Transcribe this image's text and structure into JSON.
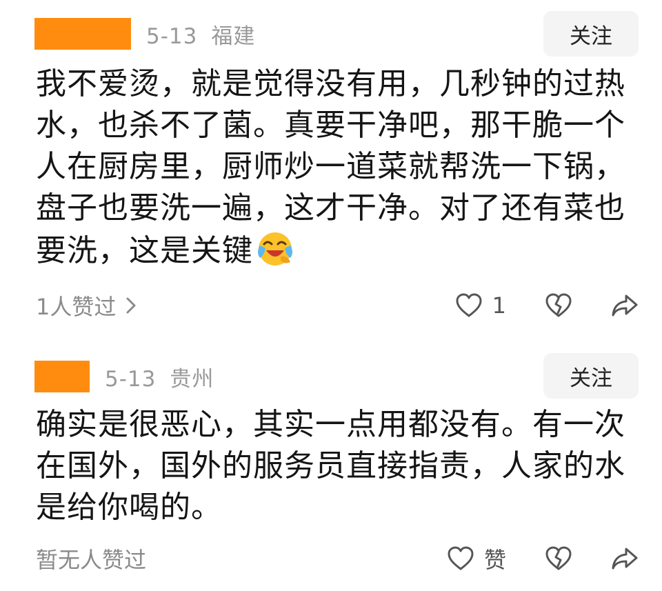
{
  "comments": [
    {
      "date": "5-13",
      "location": "福建",
      "follow_label": "关注",
      "text_lines": [
        "我不爱烫，就是觉得没有用，几秒钟的过热",
        "水，也杀不了菌。真要干净吧，那干脆一个",
        "人在厨房里，厨师炒一道菜就帮洗一下锅，",
        "盘子也要洗一遍，这才干净。对了还有菜也",
        "要洗，这是关键"
      ],
      "emoji": "laughing-crying-emoji",
      "likes_summary": "1人赞过",
      "like_count": "1",
      "icons": [
        "heart-icon",
        "broken-heart-icon",
        "share-icon",
        "chevron-right-icon"
      ]
    },
    {
      "date": "5-13",
      "location": "贵州",
      "follow_label": "关注",
      "text_lines": [
        "确实是很恶心，其实一点用都没有。有一次",
        "在国外，国外的服务员直接指责，人家的水",
        "是给你喝的。"
      ],
      "likes_summary": "暂无人赞过",
      "like_label": "赞",
      "icons": [
        "heart-icon",
        "broken-heart-icon",
        "share-icon"
      ]
    }
  ],
  "colors": {
    "redaction": "#ff8c0f",
    "meta_text": "#999999",
    "follow_bg": "#f4f4f4"
  }
}
